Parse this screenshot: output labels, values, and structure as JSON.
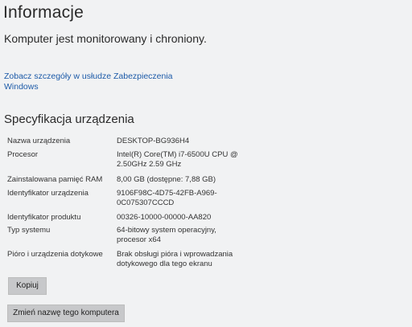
{
  "page": {
    "title": "Informacje",
    "status_text": "Komputer jest monitorowany i chroniony.",
    "security_link": "Zobacz szczegóły w usłudze Zabezpieczenia Windows",
    "section_title": "Specyfikacja urządzenia"
  },
  "specs": [
    {
      "label": "Nazwa urządzenia",
      "value": "DESKTOP-BG936H4"
    },
    {
      "label": "Procesor",
      "value": "Intel(R) Core(TM) i7-6500U CPU @ 2.50GHz   2.59 GHz"
    },
    {
      "label": "Zainstalowana pamięć RAM",
      "value": "8,00 GB (dostępne: 7,88 GB)"
    },
    {
      "label": "Identyfikator urządzenia",
      "value": "9106F98C-4D75-42FB-A969-0C075307CCCD"
    },
    {
      "label": "Identyfikator produktu",
      "value": "00326-10000-00000-AA820"
    },
    {
      "label": "Typ systemu",
      "value": "64-bitowy system operacyjny, procesor x64"
    },
    {
      "label": "Pióro i urządzenia dotykowe",
      "value": "Brak obsługi pióra i wprowadzania dotykowego dla tego ekranu"
    }
  ],
  "buttons": {
    "copy_label": "Kopiuj",
    "rename_label": "Zmień nazwę tego komputera"
  }
}
